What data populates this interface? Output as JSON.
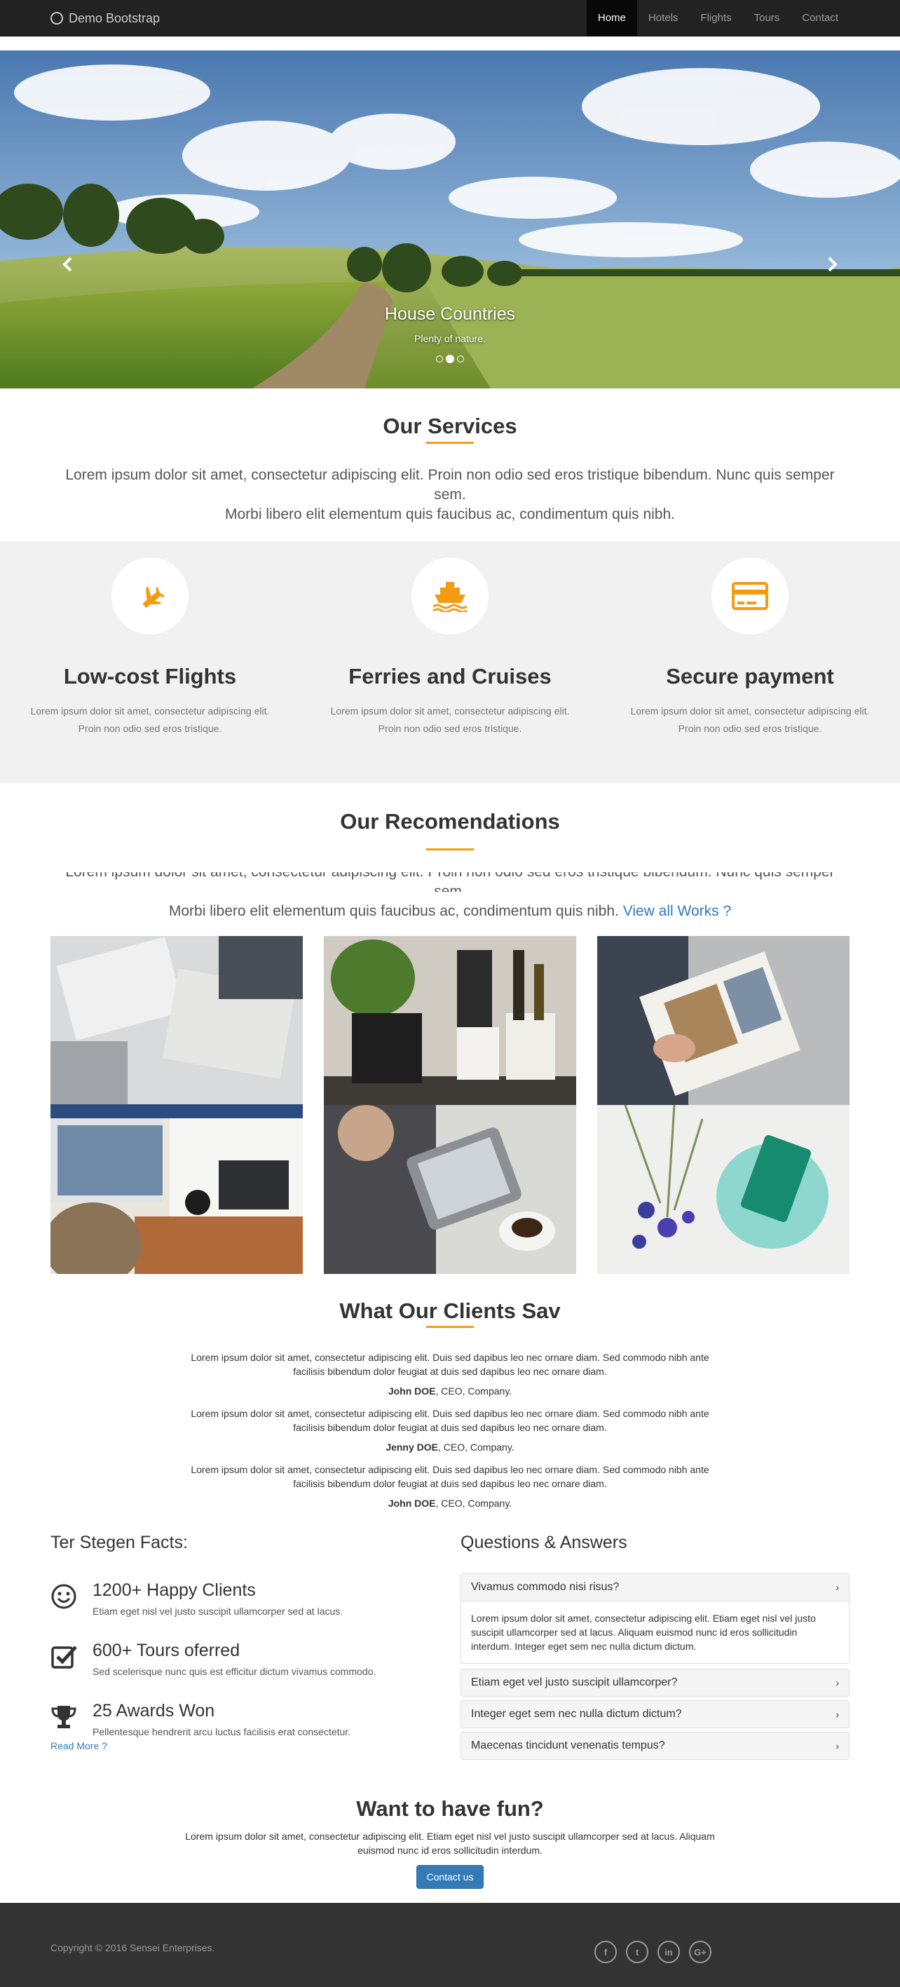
{
  "navbar": {
    "brand": "Demo Bootstrap",
    "items": [
      {
        "label": "Home",
        "active": true
      },
      {
        "label": "Hotels",
        "active": false
      },
      {
        "label": "Flights",
        "active": false
      },
      {
        "label": "Tours",
        "active": false
      },
      {
        "label": "Contact",
        "active": false
      }
    ]
  },
  "carousel": {
    "caption_title": "House Countries",
    "caption_text": "Plenty of nature.",
    "slide_count": 3,
    "active_slide": 2
  },
  "services": {
    "title": "Our Services",
    "lead_line1": "Lorem ipsum dolor sit amet, consectetur adipiscing elit. Proin non odio sed eros tristique bibendum. Nunc quis semper sem.",
    "lead_line2": "Morbi libero elit elementum quis faucibus ac, condimentum quis nibh.",
    "items": [
      {
        "icon": "plane-icon",
        "title": "Low-cost Flights",
        "desc": "Lorem ipsum dolor sit amet, consectetur adipiscing elit. Proin non odio sed eros tristique."
      },
      {
        "icon": "ship-icon",
        "title": "Ferries and Cruises",
        "desc": "Lorem ipsum dolor sit amet, consectetur adipiscing elit. Proin non odio sed eros tristique."
      },
      {
        "icon": "credit-card-icon",
        "title": "Secure payment",
        "desc": "Lorem ipsum dolor sit amet, consectetur adipiscing elit. Proin non odio sed eros tristique."
      }
    ]
  },
  "recommendations": {
    "title": "Our Recomendations",
    "lead_line1": "Lorem ipsum dolor sit amet, consectetur adipiscing elit. Proin non odio sed eros tristique bibendum. Nunc quis semper sem.",
    "lead_line2": "Morbi libero elit elementum quis faucibus ac, condimentum quis nibh.",
    "link": "View all Works ?"
  },
  "testimonials": {
    "title": "What Our Clients Sav",
    "items": [
      {
        "quote": "Lorem ipsum dolor sit amet, consectetur adipiscing elit. Duis sed dapibus leo nec ornare diam. Sed commodo nibh ante facilisis bibendum dolor feugiat at duis sed dapibus leo nec ornare diam.",
        "name": "John DOE",
        "role": ", CEO, Company."
      },
      {
        "quote": "Lorem ipsum dolor sit amet, consectetur adipiscing elit. Duis sed dapibus leo nec ornare diam. Sed commodo nibh ante facilisis bibendum dolor feugiat at duis sed dapibus leo nec ornare diam.",
        "name": "Jenny DOE",
        "role": ", CEO, Company."
      },
      {
        "quote": "Lorem ipsum dolor sit amet, consectetur adipiscing elit. Duis sed dapibus leo nec ornare diam. Sed commodo nibh ante facilisis bibendum dolor feugiat at duis sed dapibus leo nec ornare diam.",
        "name": "John DOE",
        "role": ", CEO, Company."
      }
    ]
  },
  "facts": {
    "title": "Ter Stegen Facts:",
    "items": [
      {
        "icon": "smiley-icon",
        "title": "1200+ Happy Clients",
        "desc": "Etiam eget nisl vel justo suscipit ullamcorper sed at lacus."
      },
      {
        "icon": "checkbox-icon",
        "title": "600+ Tours oferred",
        "desc": "Sed scelerisque nunc quis est efficitur dictum vivamus commodo."
      },
      {
        "icon": "trophy-icon",
        "title": "25 Awards Won",
        "desc": "Pellentesque hendrerit arcu luctus facilisis erat consectetur."
      }
    ],
    "read_more": "Read More ?"
  },
  "qa": {
    "title": "Questions & Answers",
    "items": [
      {
        "question": "Vivamus commodo nisi risus?",
        "answer": "Lorem ipsum dolor sit amet, consectetur adipiscing elit. Etiam eget nisl vel justo suscipit ullamcorper sed at lacus. Aliquam euismod nunc id eros sollicitudin interdum. Integer eget sem nec nulla dictum dictum.",
        "expanded": true
      },
      {
        "question": "Etiam eget vel justo suscipit ullamcorper?",
        "expanded": false
      },
      {
        "question": "Integer eget sem nec nulla dictum dictum?",
        "expanded": false
      },
      {
        "question": "Maecenas tincidunt venenatis tempus?",
        "expanded": false
      }
    ]
  },
  "fun": {
    "title": "Want to have fun?",
    "text": "Lorem ipsum dolor sit amet, consectetur adipiscing elit. Etiam eget nisl vel justo suscipit ullamcorper sed at lacus. Aliquam euismod nunc id eros sollicitudin interdum.",
    "button": "Contact us"
  },
  "footer": {
    "copyright": "Copyright © 2016 Sensei Enterprises.",
    "socials": [
      {
        "icon": "facebook-icon",
        "glyph": "f"
      },
      {
        "icon": "twitter-icon",
        "glyph": "t"
      },
      {
        "icon": "linkedin-icon",
        "glyph": "in"
      },
      {
        "icon": "google-plus-icon",
        "glyph": "G+"
      }
    ]
  },
  "colors": {
    "accent": "#f39c12",
    "link": "#337ab7",
    "navbar": "#222222",
    "footer": "#333333",
    "band": "#f1f1f1"
  }
}
